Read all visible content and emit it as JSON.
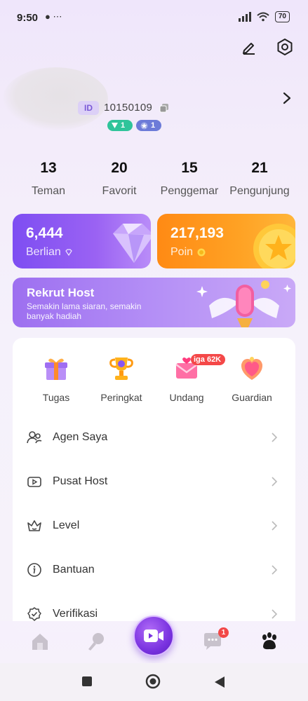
{
  "status_bar": {
    "time": "9:50",
    "left_icons": "● ⋯",
    "battery": "70"
  },
  "profile": {
    "id_badge": "ID",
    "id_number": "10150109",
    "tags": [
      {
        "icon": "chevron-down-icon",
        "value": "1",
        "color": "#2fc49a"
      },
      {
        "icon": "star-level-icon",
        "value": "1",
        "color": "#6c7bd8"
      }
    ]
  },
  "stats": [
    {
      "value": "13",
      "label": "Teman"
    },
    {
      "value": "20",
      "label": "Favorit"
    },
    {
      "value": "15",
      "label": "Penggemar"
    },
    {
      "value": "21",
      "label": "Pengunjung"
    }
  ],
  "wallet": {
    "berlian": {
      "value": "6,444",
      "label": "Berlian",
      "color": "#8a56f2"
    },
    "poin": {
      "value": "217,193",
      "label": "Poin",
      "color": "#ff9a1f"
    }
  },
  "banner": {
    "title": "Rekrut Host",
    "subtitle": "Semakin lama siaran, semakin banyak hadiah"
  },
  "quick_actions": [
    {
      "label": "Tugas",
      "icon": "gift-icon"
    },
    {
      "label": "Peringkat",
      "icon": "trophy-icon"
    },
    {
      "label": "Undang",
      "icon": "invite-envelope-icon"
    },
    {
      "label": "Guardian",
      "icon": "guardian-heart-icon"
    }
  ],
  "promo_badge": "iga 62K",
  "menu": [
    {
      "label": "Agen Saya",
      "icon": "agent-icon"
    },
    {
      "label": "Pusat Host",
      "icon": "video-host-icon"
    },
    {
      "label": "Level",
      "icon": "crown-icon"
    },
    {
      "label": "Bantuan",
      "icon": "info-icon"
    },
    {
      "label": "Verifikasi",
      "icon": "verify-icon"
    }
  ],
  "bottom_nav": {
    "chat_badge": "1",
    "items": [
      "home-icon",
      "mic-icon",
      "live-camera-icon",
      "chat-icon",
      "paw-icon"
    ]
  }
}
